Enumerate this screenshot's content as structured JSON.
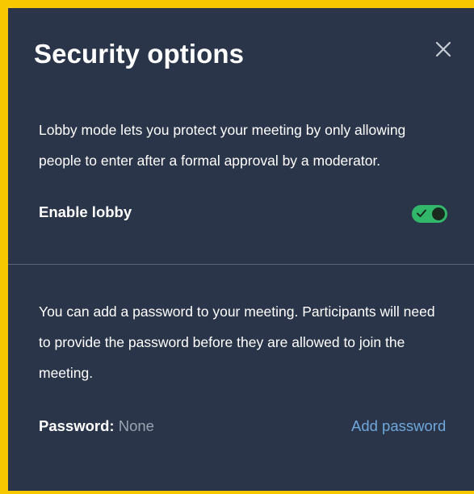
{
  "dialog": {
    "title": "Security options",
    "close_icon": "close-icon"
  },
  "lobby": {
    "description": "Lobby mode lets you protect your meeting by only allowing people to enter after a formal approval by a moderator.",
    "toggle_label": "Enable lobby",
    "enabled": true,
    "toggle_color": "#31b76a"
  },
  "password": {
    "description": "You can add a password to your meeting. Participants will need to provide the password before they are allowed to join the meeting.",
    "label": "Password:",
    "value": "None",
    "add_link": "Add password",
    "link_color": "#6fa8dc"
  },
  "colors": {
    "frame": "#f7c800",
    "background": "#2a3549"
  }
}
